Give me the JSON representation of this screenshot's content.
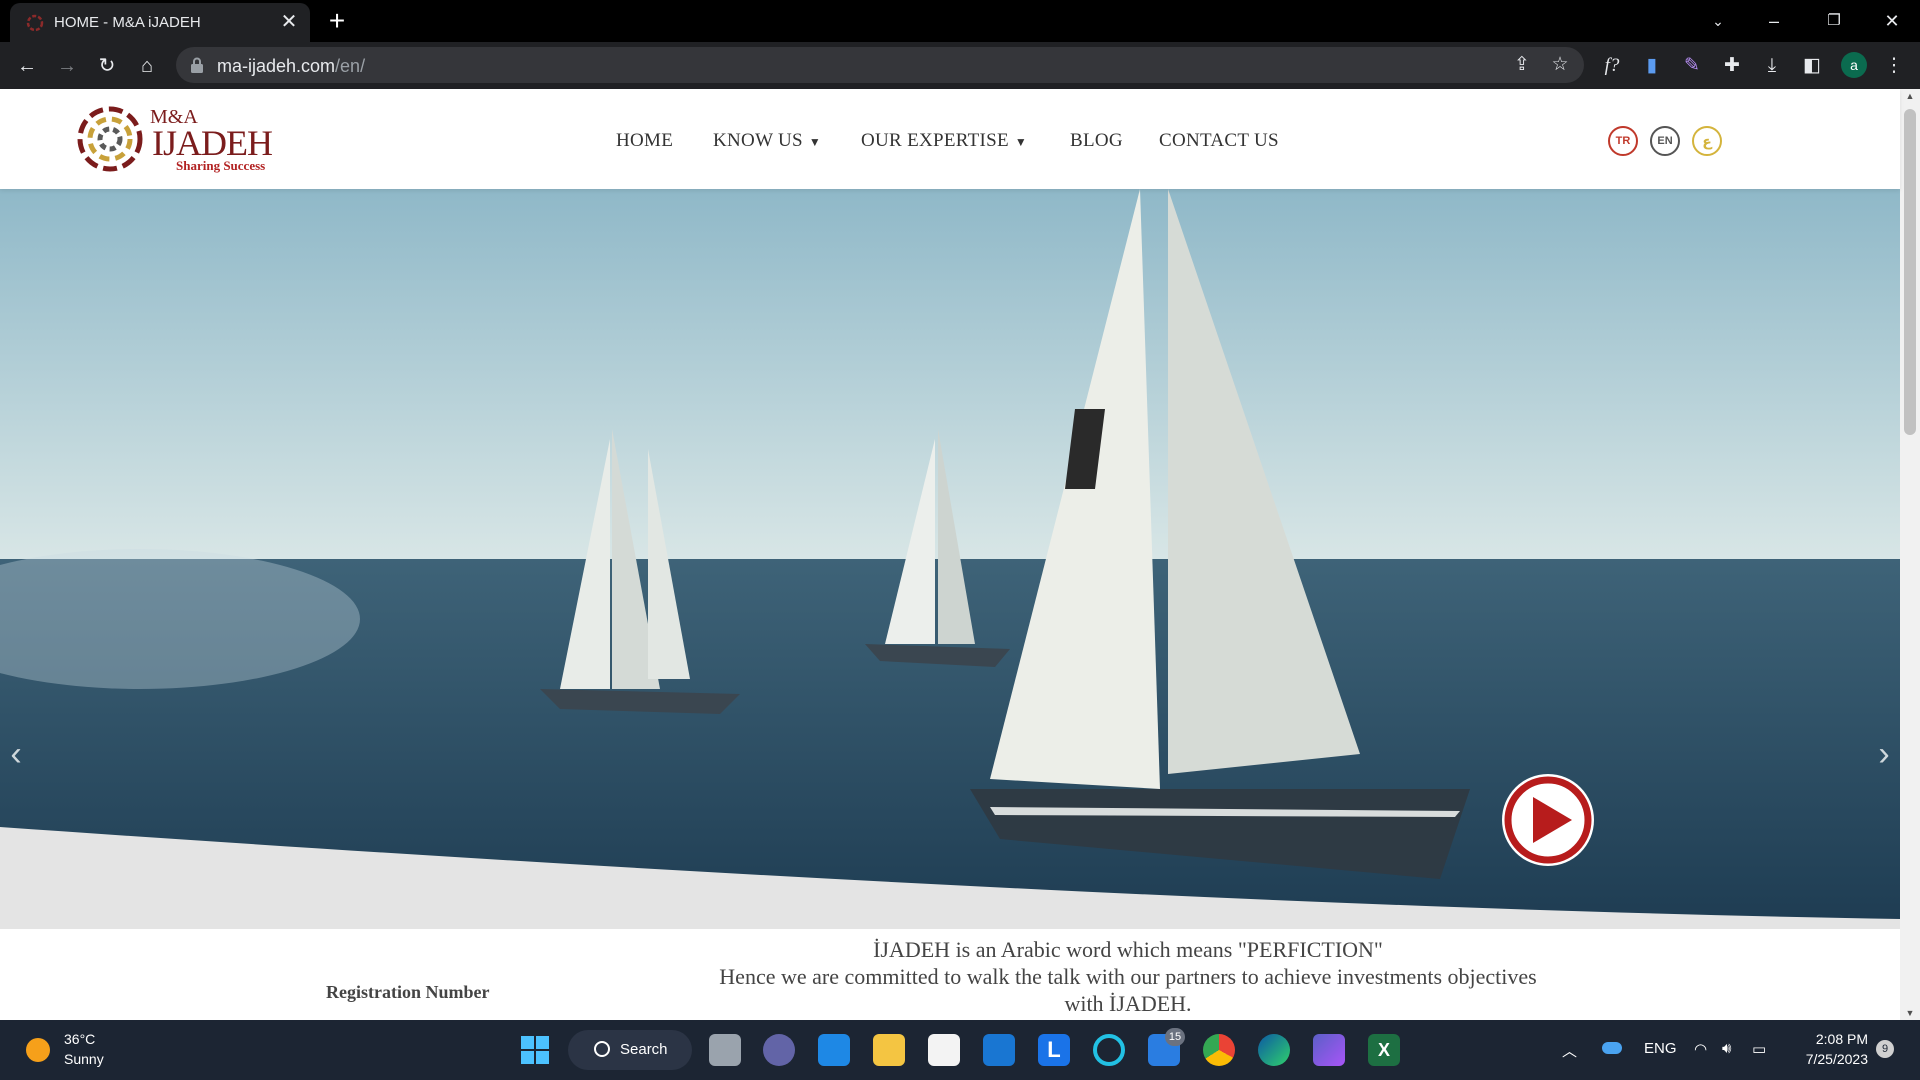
{
  "browser": {
    "tab_title": "HOME - M&A iJADEH",
    "tab_close": "✕",
    "new_tab": "+",
    "url_host": "ma-ijadeh.com",
    "url_path": "/en/",
    "profile_initial": "a"
  },
  "site": {
    "logo": {
      "top": "M&A",
      "main": "IJADEH",
      "sub": "Sharing Success"
    },
    "nav": [
      {
        "label": "HOME"
      },
      {
        "label": "KNOW US"
      },
      {
        "label": "OUR EXPERTISE"
      },
      {
        "label": "BLOG"
      },
      {
        "label": "CONTACT US"
      }
    ],
    "languages": [
      {
        "code": "TR",
        "color": "#c0392b"
      },
      {
        "code": "EN",
        "color": "#555555"
      },
      {
        "code": "ع",
        "color": "#d4b43c"
      }
    ],
    "intro_lines": [
      "İJADEH is an Arabic word which means \"PERFICTION\"",
      "Hence we are committed to walk the talk with our partners to achieve investments objectives",
      "with İJADEH."
    ],
    "registration_label": "Registration Number",
    "accent_color": "#b71c1c"
  },
  "taskbar": {
    "weather_temp": "36°C",
    "weather_cond": "Sunny",
    "search_label": "Search",
    "badge_count": "15",
    "lang": "ENG",
    "time": "2:08 PM",
    "date": "7/25/2023",
    "notifications": "9"
  }
}
